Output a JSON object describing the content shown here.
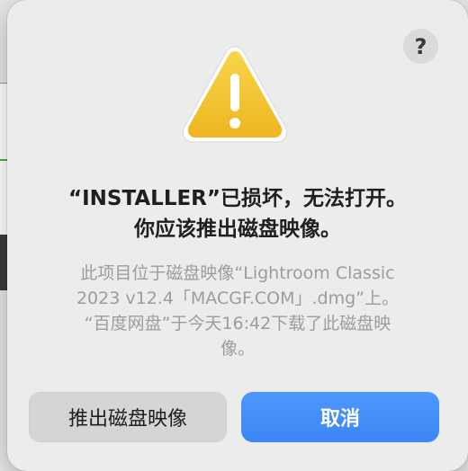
{
  "dialog": {
    "help_label": "?",
    "icon": "warning-triangle-icon",
    "title_line1": "“INSTALLER”已损坏，无法打开。",
    "title_line2": "你应该推出磁盘映像。",
    "message_lines": [
      "此项目位于磁盘映像“Lightroom Classic",
      "2023 v12.4「MACGF.COM」.dmg”上。",
      "“百度网盘”于今天16:42下载了此磁盘映",
      "像。"
    ],
    "buttons": {
      "eject": "推出磁盘映像",
      "cancel": "取消"
    }
  },
  "colors": {
    "accent": "#3d87f5",
    "warning": "#f3c12b",
    "secondary_text": "#9c9c9c"
  }
}
